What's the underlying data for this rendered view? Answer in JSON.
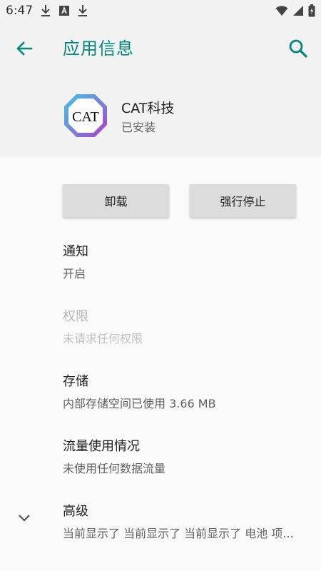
{
  "status_bar": {
    "time": "6:47",
    "left_icons": [
      "download-icon",
      "text-a-icon",
      "download-icon"
    ],
    "right_icons": [
      "wifi-icon",
      "signal-icon",
      "battery-icon"
    ]
  },
  "app_bar": {
    "title": "应用信息",
    "back_icon": "arrow-back-icon",
    "search_icon": "search-icon",
    "accent_color": "#00897b"
  },
  "app_header": {
    "icon_text": "CAT",
    "app_name": "CAT科技",
    "install_status": "已安装"
  },
  "buttons": {
    "uninstall": "卸载",
    "force_stop": "强行停止"
  },
  "preferences": [
    {
      "title": "通知",
      "summary": "开启",
      "enabled": true
    },
    {
      "title": "权限",
      "summary": "未请求任何权限",
      "enabled": false
    },
    {
      "title": "存储",
      "summary": "内部存储空间已使用 3.66 MB",
      "enabled": true
    },
    {
      "title": "流量使用情况",
      "summary": "未使用任何数据流量",
      "enabled": true
    },
    {
      "title": "高级",
      "summary": "当前显示了 当前显示了 当前显示了 电池 项...",
      "enabled": true
    }
  ]
}
